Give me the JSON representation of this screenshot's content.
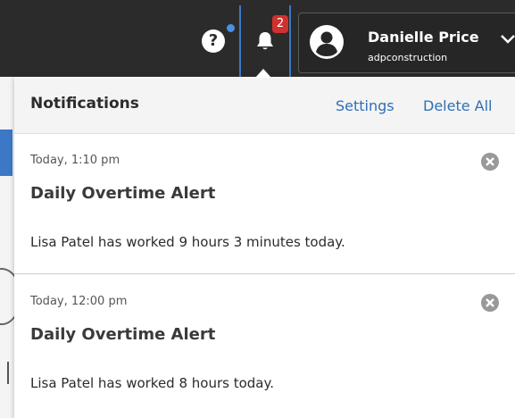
{
  "header": {
    "help_label": "?",
    "notification_count": "2",
    "user": {
      "name": "Danielle Price",
      "company": "adpconstruction"
    }
  },
  "panel": {
    "title": "Notifications",
    "settings_label": "Settings",
    "delete_all_label": "Delete All"
  },
  "notifications": [
    {
      "time": "Today, 1:10 pm",
      "title": "Daily Overtime Alert",
      "body": "Lisa Patel has worked 9 hours 3 minutes today."
    },
    {
      "time": "Today, 12:00 pm",
      "title": "Daily Overtime Alert",
      "body": "Lisa Patel has worked 8 hours today."
    }
  ],
  "colors": {
    "header_bg": "#2b2b2b",
    "accent_blue": "#3d78c7",
    "link_blue": "#2e6fb8",
    "badge_red": "#d0312d"
  },
  "icons": {
    "help": "question-icon",
    "bell": "bell-icon",
    "avatar": "user-avatar-icon",
    "chevron": "chevron-down-icon",
    "close": "close-circle-icon"
  }
}
